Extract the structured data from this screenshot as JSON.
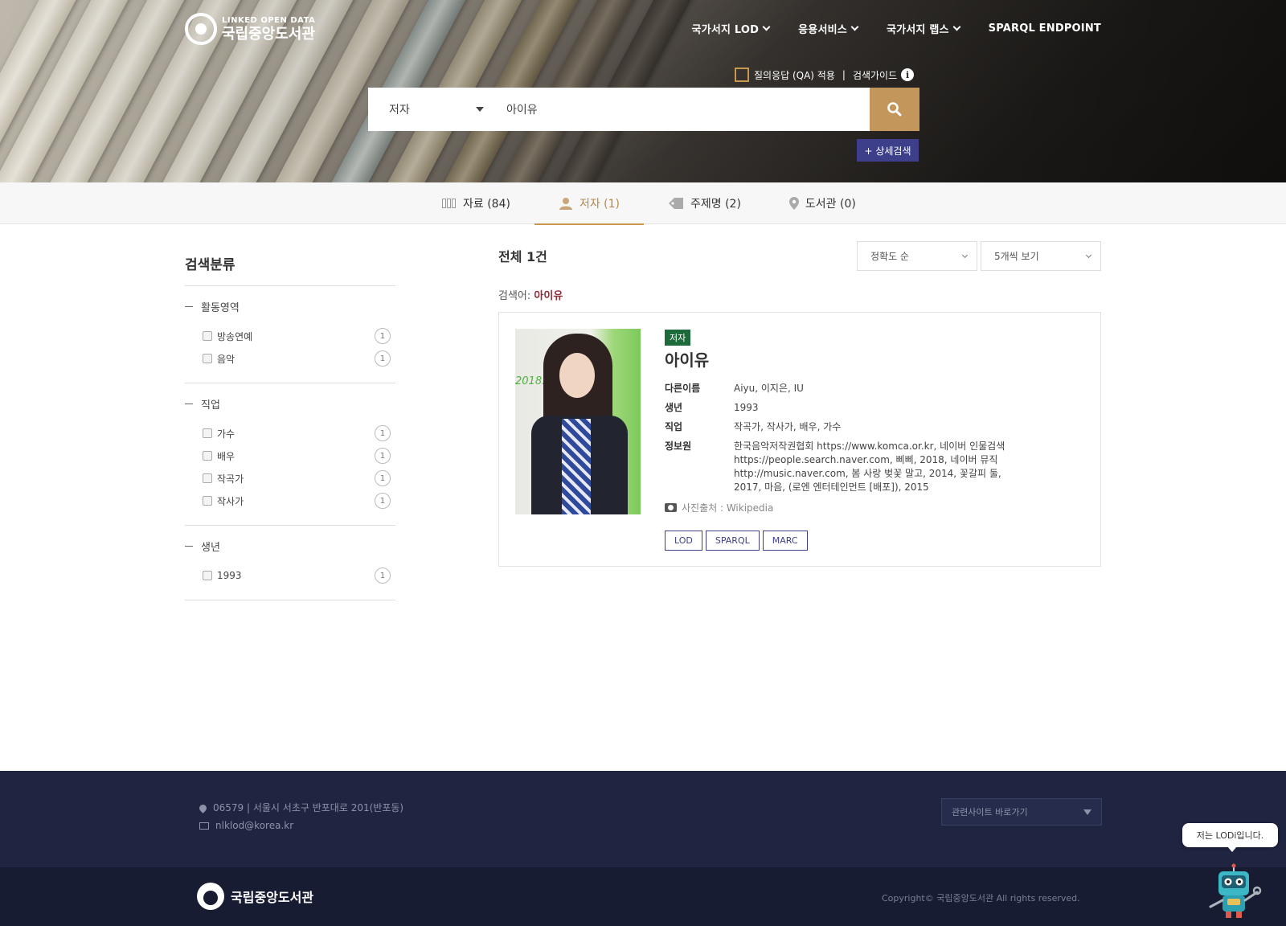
{
  "header": {
    "logo_sub": "LINKED OPEN DATA",
    "logo_main": "국립중앙도서관",
    "nav": [
      {
        "label": "국가서지 LOD"
      },
      {
        "label": "응용서비스"
      },
      {
        "label": "국가서지 랩스"
      },
      {
        "label": "SPARQL ENDPOINT"
      }
    ],
    "qa_label": "질의응답 (QA) 적용",
    "qa_sep": "|",
    "guide_label": "검색가이드",
    "info_glyph": "i"
  },
  "search": {
    "scope": "저자",
    "value": "아이유",
    "advanced_label": "+ 상세검색"
  },
  "tabs": [
    {
      "label": "자료 (84)",
      "icon": "bookshelf-icon"
    },
    {
      "label": "저자 (1)",
      "icon": "person-icon"
    },
    {
      "label": "주제명 (2)",
      "icon": "tag-icon"
    },
    {
      "label": "도서관 (0)",
      "icon": "location-pin-icon"
    }
  ],
  "sidebar": {
    "title": "검색분류",
    "facets": [
      {
        "title": "활동영역",
        "items": [
          {
            "label": "방송연예",
            "count": "1"
          },
          {
            "label": "음악",
            "count": "1"
          }
        ]
      },
      {
        "title": "직업",
        "items": [
          {
            "label": "가수",
            "count": "1"
          },
          {
            "label": "배우",
            "count": "1"
          },
          {
            "label": "작곡가",
            "count": "1"
          },
          {
            "label": "작사가",
            "count": "1"
          }
        ]
      },
      {
        "title": "생년",
        "items": [
          {
            "label": "1993",
            "count": "1"
          }
        ]
      }
    ]
  },
  "results": {
    "total": "전체 1건",
    "sort": "정확도 순",
    "per_page": "5개씩 보기",
    "query_prefix": "검색어: ",
    "query_value": "아이유"
  },
  "card": {
    "badge": "저자",
    "name": "아이유",
    "photo_text": "2018. 0",
    "fields": [
      {
        "label": "다른이름",
        "value": "Aiyu, 이지은, IU"
      },
      {
        "label": "생년",
        "value": "1993"
      },
      {
        "label": "직업",
        "value": "작곡가, 작사가, 배우, 가수"
      },
      {
        "label": "정보원",
        "value": "한국음악저작권협회 https://www.komca.or.kr, 네이버 인물검색 https://people.search.naver.com, 삐삐, 2018, 네이버 뮤직 http://music.naver.com, 봄 사랑 벚꽃 말고, 2014, 꽃갈피 둘, 2017, 마음, (로엔 엔터테인먼트 [배포]), 2015"
      }
    ],
    "credit": "사진출처 : Wikipedia",
    "buttons": [
      {
        "label": "LOD"
      },
      {
        "label": "SPARQL"
      },
      {
        "label": "MARC"
      }
    ]
  },
  "footer": {
    "address": "06579 | 서울시 서초구 반포대로 201(반포동)",
    "email": "nlklod@korea.kr",
    "related": "관련사이트 바로가기",
    "logo": "국립중앙도서관",
    "copyright": "Copyright© 국립중앙도서관 All rights reserved."
  },
  "chatbot": {
    "bubble": "저는 LODi입니다."
  },
  "colors": {
    "accent_gold": "#c3975b",
    "advanced_button": "#3e3f8a",
    "author_badge": "#1f6a3a",
    "query_highlight": "#8b2e3a",
    "footer_top": "#1f2440",
    "footer_bottom": "#181c33"
  }
}
